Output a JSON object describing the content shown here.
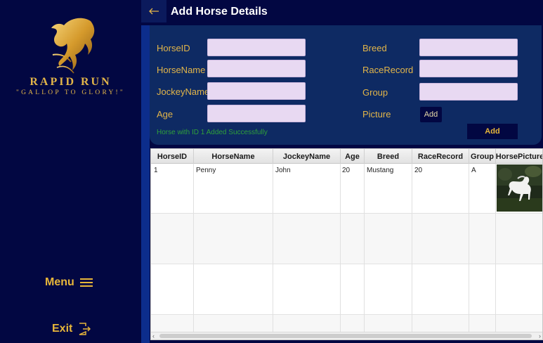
{
  "sidebar": {
    "brand_name": "RAPID RUN",
    "tagline": "\"GALLOP TO GLORY!\"",
    "menu_label": "Menu",
    "exit_label": "Exit"
  },
  "header": {
    "title": "Add Horse Details"
  },
  "form": {
    "horse_id_label": "HorseID",
    "horse_name_label": "HorseName",
    "jockey_name_label": "JockeyName",
    "age_label": "Age",
    "breed_label": "Breed",
    "race_record_label": "RaceRecord",
    "group_label": "Group",
    "picture_label": "Picture",
    "picture_add_label": "Add",
    "add_button_label": "Add",
    "status_message": "Horse with ID 1 Added Successfully"
  },
  "table": {
    "columns": [
      "HorseID",
      "HorseName",
      "JockeyName",
      "Age",
      "Breed",
      "RaceRecord",
      "Group",
      "HorsePicture"
    ],
    "rows": [
      {
        "horse_id": "1",
        "horse_name": "Penny",
        "jockey_name": "John",
        "age": "20",
        "breed": "Mustang",
        "race_record": "20",
        "group": "A",
        "picture_icon": "white-horse-photo"
      }
    ]
  },
  "colors": {
    "background": "#020742",
    "gold": "#e2b549",
    "panel": "#0e2a63",
    "input": "#e8d9f2",
    "success": "#2fa03a"
  }
}
